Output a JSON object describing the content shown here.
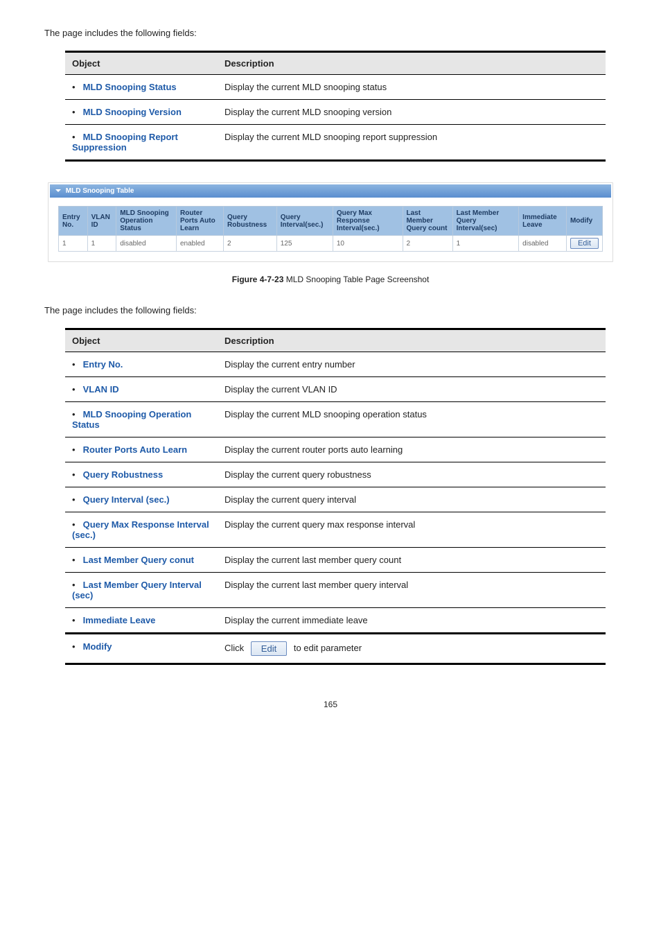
{
  "intro1": "The page includes the following fields:",
  "intro2": "The page includes the following fields:",
  "table1": {
    "head_obj": "Object",
    "head_desc": "Description",
    "rows": [
      {
        "obj": "MLD Snooping Status",
        "desc": "Display the current MLD snooping status"
      },
      {
        "obj": "MLD Snooping Version",
        "desc": "Display the current MLD snooping version"
      },
      {
        "obj": "MLD Snooping Report Suppression",
        "desc": "Display the current MLD snooping report suppression"
      }
    ]
  },
  "panel": {
    "title": "MLD Snooping Table",
    "headers": [
      "Entry No.",
      "VLAN ID",
      "MLD Snooping Operation Status",
      "Router Ports Auto Learn",
      "Query Robustness",
      "Query Interval(sec.)",
      "Query Max Response Interval(sec.)",
      "Last Member Query count",
      "Last Member Query Interval(sec)",
      "Immediate Leave",
      "Modify"
    ],
    "row": [
      "1",
      "1",
      "disabled",
      "enabled",
      "2",
      "125",
      "10",
      "2",
      "1",
      "disabled"
    ],
    "edit_label": "Edit"
  },
  "caption_bold": "Figure 4-7-23",
  "caption_rest": " MLD Snooping Table Page Screenshot",
  "table2": {
    "head_obj": "Object",
    "head_desc": "Description",
    "rows": [
      {
        "obj": "Entry No.",
        "desc": "Display the current entry number"
      },
      {
        "obj": "VLAN ID",
        "desc": "Display the current VLAN ID"
      },
      {
        "obj": "MLD Snooping Operation Status",
        "desc": "Display the current MLD snooping operation status"
      },
      {
        "obj": "Router Ports Auto Learn",
        "desc": "Display the current router ports auto learning"
      },
      {
        "obj": "Query Robustness",
        "desc": "Display the current query robustness"
      },
      {
        "obj": "Query Interval (sec.)",
        "desc": "Display the current query interval"
      },
      {
        "obj": "Query Max Response Interval (sec.)",
        "desc": "Display the current query max response interval"
      },
      {
        "obj": "Last Member Query conut",
        "desc": "Display the current last member query count"
      },
      {
        "obj": "Last Member Query Interval (sec)",
        "desc": "Display the current last member query interval"
      },
      {
        "obj": "Immediate Leave",
        "desc": "Display the current immediate leave"
      }
    ],
    "modify_obj": "Modify",
    "modify_pre": "Click",
    "modify_btn": "Edit",
    "modify_post": "to edit parameter"
  },
  "page_number": "165"
}
